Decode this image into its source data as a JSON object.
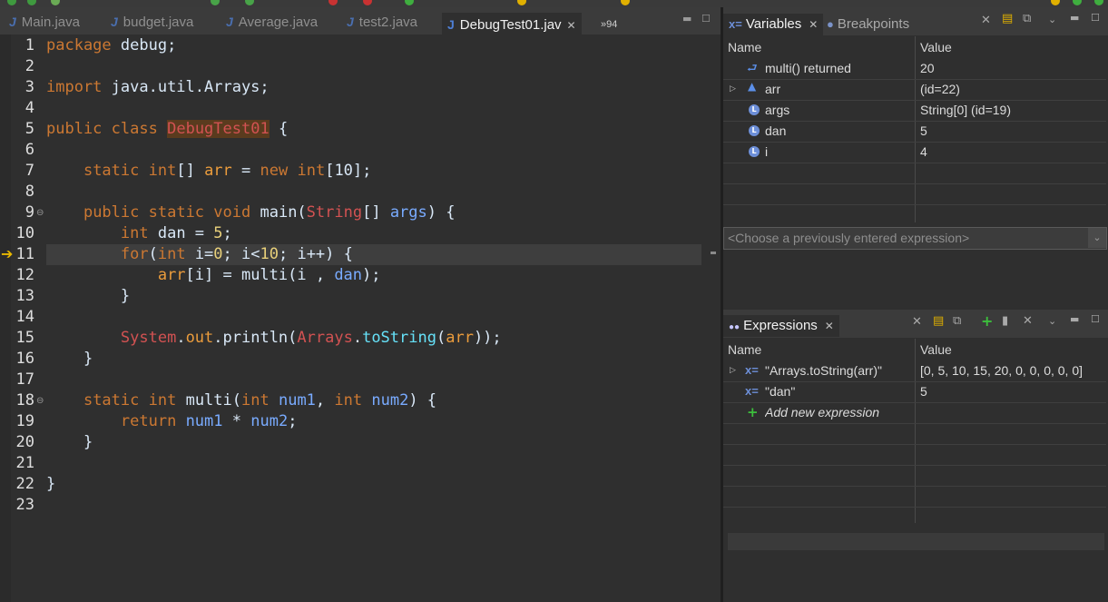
{
  "editor": {
    "tabs": [
      {
        "label": "Main.java",
        "active": false
      },
      {
        "label": "budget.java",
        "active": false
      },
      {
        "label": "Average.java",
        "active": false
      },
      {
        "label": "test2.java",
        "active": false
      },
      {
        "label": "DebugTest01.jav",
        "active": true
      }
    ],
    "overflow_label": "»94",
    "current_line": 11,
    "lines": [
      {
        "n": "1"
      },
      {
        "n": "2"
      },
      {
        "n": "3"
      },
      {
        "n": "4"
      },
      {
        "n": "5"
      },
      {
        "n": "6"
      },
      {
        "n": "7"
      },
      {
        "n": "8"
      },
      {
        "n": "9"
      },
      {
        "n": "10"
      },
      {
        "n": "11"
      },
      {
        "n": "12"
      },
      {
        "n": "13"
      },
      {
        "n": "14"
      },
      {
        "n": "15"
      },
      {
        "n": "16"
      },
      {
        "n": "17"
      },
      {
        "n": "18"
      },
      {
        "n": "19"
      },
      {
        "n": "20"
      },
      {
        "n": "21"
      },
      {
        "n": "22"
      },
      {
        "n": "23"
      }
    ],
    "code": {
      "l1": "package debug;",
      "l3": "import java.util.Arrays;",
      "l5_a": "public class ",
      "l5_b": "DebugTest01",
      "l5_c": " {",
      "l7_a": "    static int[] ",
      "l7_b": "arr",
      "l7_c": " = new int[",
      "l7_d": "10",
      "l7_e": "];",
      "l9_a": "    public static void main(",
      "l9_b": "String",
      "l9_c": "[] ",
      "l9_d": "args",
      "l9_e": ") {",
      "l10_a": "        int dan = ",
      "l10_b": "5",
      "l10_c": ";",
      "l11_a": "        for(int i=",
      "l11_b": "0",
      "l11_c": "; i<",
      "l11_d": "10",
      "l11_e": "; i++) {",
      "l12_a": "            ",
      "l12_b": "arr",
      "l12_c": "[i] = multi(i , ",
      "l12_d": "dan",
      "l12_e": ");",
      "l13": "        }",
      "l15_a": "        ",
      "l15_b": "System",
      "l15_c": ".",
      "l15_d": "out",
      "l15_e": ".println(",
      "l15_f": "Arrays",
      "l15_g": ".",
      "l15_h": "toString",
      "l15_i": "(",
      "l15_j": "arr",
      "l15_k": "));",
      "l16": "    }",
      "l18_a": "    static int multi(int ",
      "l18_b": "num1",
      "l18_c": ", int ",
      "l18_d": "num2",
      "l18_e": ") {",
      "l19_a": "        return ",
      "l19_b": "num1",
      "l19_c": " * ",
      "l19_d": "num2",
      "l19_e": ";",
      "l20": "    }",
      "l22": "}"
    }
  },
  "variables_view": {
    "tabs": [
      {
        "label": "Variables",
        "active": true
      },
      {
        "label": "Breakpoints",
        "active": false
      }
    ],
    "columns": {
      "name": "Name",
      "value": "Value"
    },
    "rows": [
      {
        "name": "multi() returned",
        "value": "20",
        "icon": "return-value-icon",
        "expandable": false
      },
      {
        "name": "arr",
        "value": "(id=22)",
        "icon": "static-field-icon",
        "expandable": true
      },
      {
        "name": "args",
        "value": "String[0]  (id=19)",
        "icon": "local-variable-icon",
        "expandable": false
      },
      {
        "name": "dan",
        "value": "5",
        "icon": "local-variable-icon",
        "expandable": false
      },
      {
        "name": "i",
        "value": "4",
        "icon": "local-variable-icon",
        "expandable": false
      }
    ],
    "expression_placeholder": "<Choose a previously entered expression>"
  },
  "expressions_view": {
    "tab_label": "Expressions",
    "columns": {
      "name": "Name",
      "value": "Value"
    },
    "rows": [
      {
        "name": "\"Arrays.toString(arr)\"",
        "value": "[0, 5, 10, 15, 20, 0, 0, 0, 0, 0]",
        "expandable": true
      },
      {
        "name": "\"dan\"",
        "value": "5",
        "expandable": false
      }
    ],
    "add_label": "Add new expression"
  },
  "colors": {
    "background": "#2f2f2f",
    "keyword": "#cc7832",
    "class_name": "#d25252",
    "field": "#66e1f8",
    "variable": "#79abff",
    "number": "#7fb347",
    "debug_arrow": "#e8b800"
  }
}
